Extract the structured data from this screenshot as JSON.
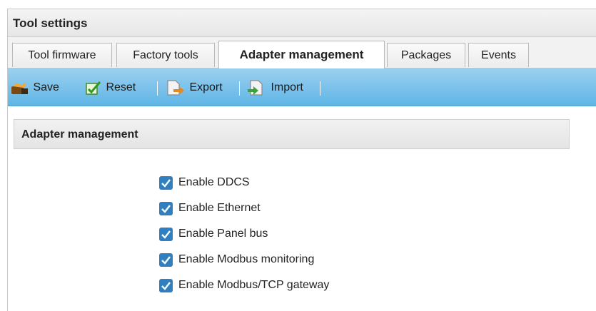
{
  "window": {
    "title": "Tool settings"
  },
  "tabs": [
    {
      "label": "Tool firmware",
      "active": false
    },
    {
      "label": "Factory tools",
      "active": false
    },
    {
      "label": "Adapter management",
      "active": true
    },
    {
      "label": "Packages",
      "active": false
    },
    {
      "label": "Events",
      "active": false
    }
  ],
  "toolbar": {
    "save_label": "Save",
    "reset_label": "Reset",
    "export_label": "Export",
    "import_label": "Import",
    "icons": [
      "save-icon",
      "reset-icon",
      "export-icon",
      "import-icon"
    ]
  },
  "panel": {
    "title": "Adapter management"
  },
  "options": [
    {
      "label": "Enable DDCS",
      "checked": true
    },
    {
      "label": "Enable Ethernet",
      "checked": true
    },
    {
      "label": "Enable Panel bus",
      "checked": true
    },
    {
      "label": "Enable Modbus monitoring",
      "checked": true
    },
    {
      "label": "Enable Modbus/TCP gateway",
      "checked": true
    }
  ],
  "colors": {
    "toolbar": "#6cbbe9",
    "checkbox": "#2f7fc1"
  }
}
